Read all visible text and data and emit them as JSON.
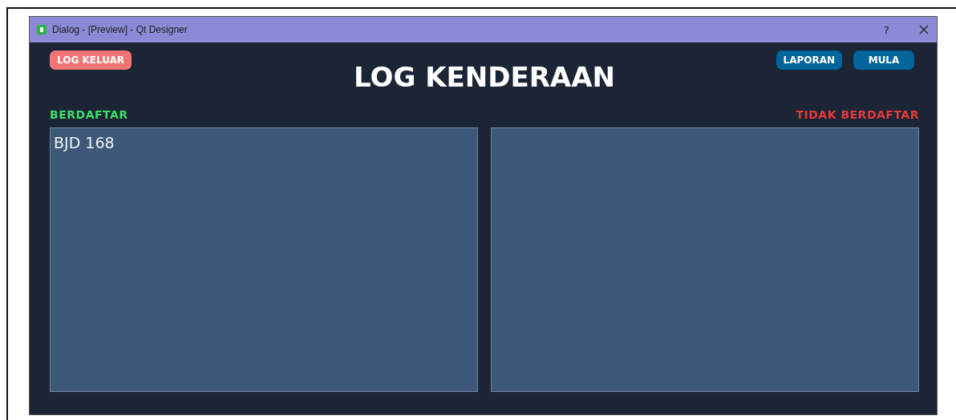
{
  "window": {
    "title": "Dialog - [Preview] - Qt Designer",
    "help": "?"
  },
  "buttons": [
    {
      "label": "LOG KELUAR",
      "kind": "danger"
    },
    {
      "label": "LAPORAN",
      "kind": "primary"
    },
    {
      "label": "MULA",
      "kind": "primary"
    }
  ],
  "heading": "LOG KENDERAAN",
  "lists": [
    {
      "label": "BERDAFTAR",
      "color": "#3ddc67",
      "items": [
        "BJD 168"
      ]
    },
    {
      "label": "TIDAK BERDAFTAR",
      "color": "#e8383b"
    }
  ]
}
